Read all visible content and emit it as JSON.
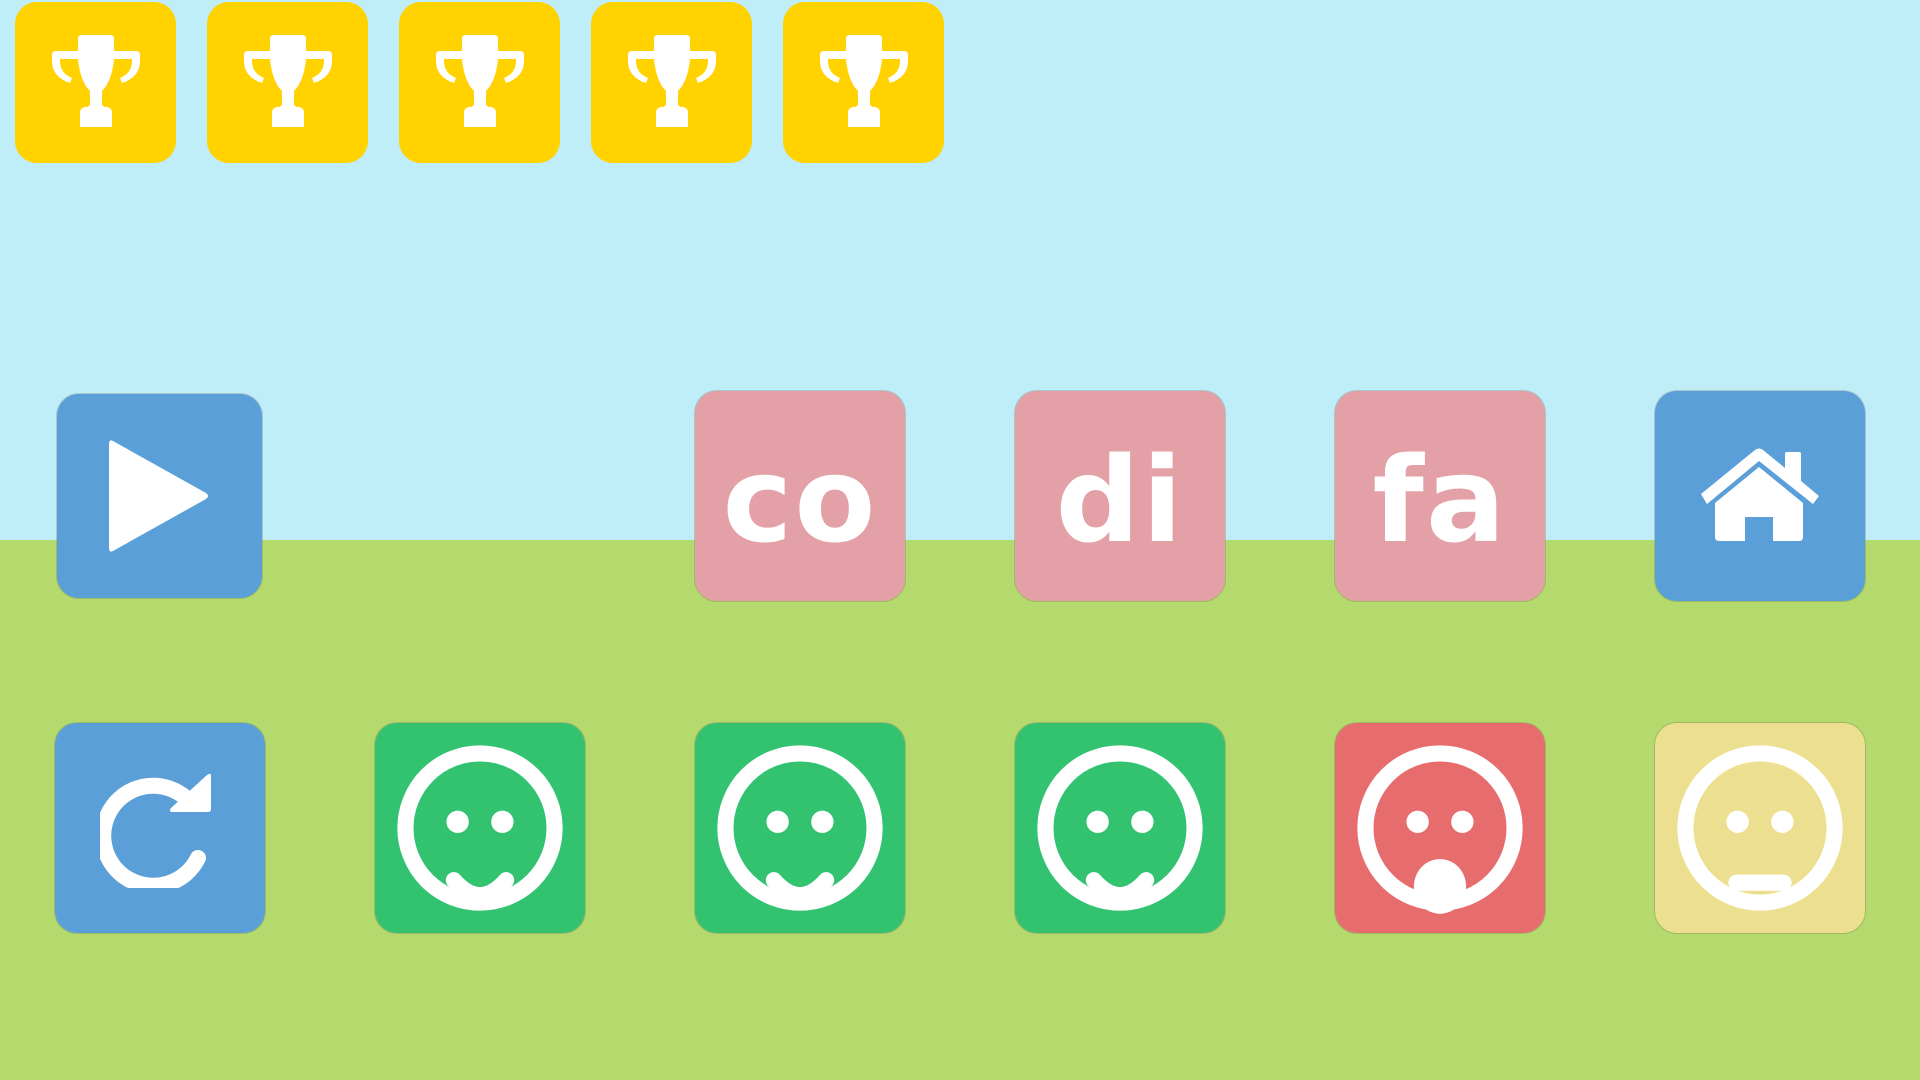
{
  "colors": {
    "sky": "#bfedf8",
    "ground": "#b4da6e",
    "trophy": "#ffd200",
    "control_blue": "#5a9fd8",
    "syllable_pink": "#e3a0a6",
    "face_happy": "#32c270",
    "face_surprised": "#e76c6d",
    "face_neutral": "#ece090"
  },
  "trophies": [
    {
      "icon": "trophy-icon"
    },
    {
      "icon": "trophy-icon"
    },
    {
      "icon": "trophy-icon"
    },
    {
      "icon": "trophy-icon"
    },
    {
      "icon": "trophy-icon"
    }
  ],
  "controls": {
    "play": {
      "icon": "play-icon"
    },
    "home": {
      "icon": "home-icon"
    },
    "restart": {
      "icon": "restart-icon"
    }
  },
  "syllables": [
    "co",
    "di",
    "fa"
  ],
  "feedback": [
    {
      "state": "happy",
      "icon": "smiley-happy-icon"
    },
    {
      "state": "happy",
      "icon": "smiley-happy-icon"
    },
    {
      "state": "happy",
      "icon": "smiley-happy-icon"
    },
    {
      "state": "surprised",
      "icon": "smiley-surprised-icon"
    },
    {
      "state": "neutral",
      "icon": "smiley-neutral-icon"
    }
  ]
}
